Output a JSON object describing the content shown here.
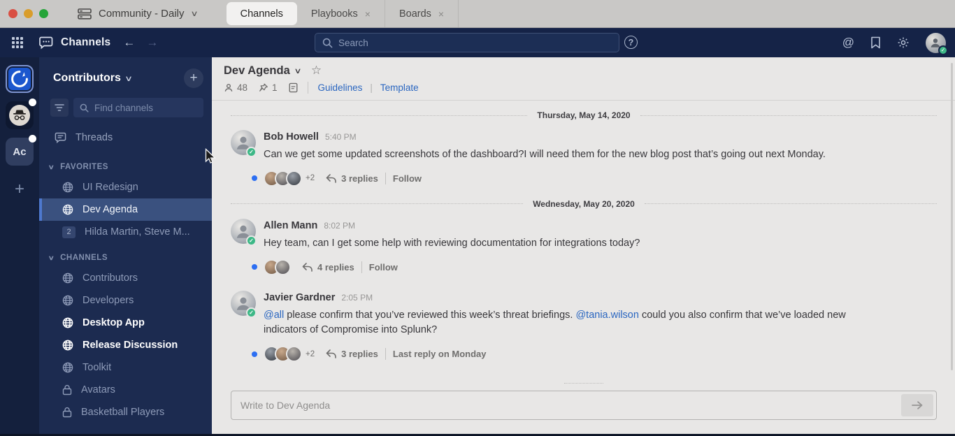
{
  "os_bar": {
    "workspace_name": "Community - Daily",
    "tabs": [
      {
        "label": "Channels"
      },
      {
        "label": "Playbooks",
        "close": "×"
      },
      {
        "label": "Boards",
        "close": "×"
      }
    ]
  },
  "global_header": {
    "product_name": "Channels",
    "search_placeholder": "Search",
    "at_symbol": "@"
  },
  "team_sidebar": {
    "teams": [
      {
        "name": "mattermost-community",
        "active": true
      },
      {
        "name": "incognito-team",
        "badge": true
      },
      {
        "name": "Ac",
        "badge": true
      }
    ],
    "add_label": "+"
  },
  "sidebar": {
    "team_title": "Contributors",
    "add_label": "+",
    "find_placeholder": "Find channels",
    "threads_label": "Threads",
    "favorites": {
      "label": "FAVORITES",
      "items": [
        {
          "label": "UI Redesign",
          "icon": "globe"
        },
        {
          "label": "Dev Agenda",
          "icon": "globe",
          "selected": true
        },
        {
          "label": "Hilda Martin, Steve M...",
          "badge": "2"
        }
      ]
    },
    "channels": {
      "label": "CHANNELS",
      "items": [
        {
          "label": "Contributors",
          "icon": "globe"
        },
        {
          "label": "Developers",
          "icon": "globe"
        },
        {
          "label": "Desktop App",
          "icon": "globe",
          "unread": true
        },
        {
          "label": "Release Discussion",
          "icon": "globe",
          "unread": true
        },
        {
          "label": "Toolkit",
          "icon": "globe"
        },
        {
          "label": "Avatars",
          "icon": "lock"
        },
        {
          "label": "Basketball Players",
          "icon": "lock"
        }
      ]
    }
  },
  "channel": {
    "title": "Dev Agenda",
    "member_count": "48",
    "pinned_count": "1",
    "links": {
      "guidelines": "Guidelines",
      "template": "Template"
    },
    "link_sep": "|"
  },
  "feed": {
    "divider1": "Thursday, May 14, 2020",
    "post1": {
      "author": "Bob Howell",
      "time": "5:40 PM",
      "text": "Can we get some updated screenshots of the dashboard?I will need them for the new blog post that’s going out next Monday.",
      "overflow": "+2",
      "replies": "3 replies",
      "action": "Follow"
    },
    "divider2": "Wednesday, May 20, 2020",
    "post2": {
      "author": "Allen Mann",
      "time": "8:02 PM",
      "text": "Hey team, can I get some help with reviewing documentation for integrations today?",
      "replies": "4 replies",
      "action": "Follow"
    },
    "post3": {
      "author": "Javier Gardner",
      "time": "2:05 PM",
      "mention1": "@all",
      "text1": " please confirm that you’ve reviewed this week’s threat briefings. ",
      "mention2": "@tania.wilson",
      "text2": " could you also confirm that we’ve loaded new indicators of Compromise into Splunk?",
      "overflow": "+2",
      "replies": "3 replies",
      "action": "Last reply on Monday"
    }
  },
  "composer": {
    "placeholder": "Write to Dev Agenda"
  },
  "colors": {
    "header_navy": "#152347",
    "team_sidebar": "#14203d",
    "channel_sidebar": "#1c2b50",
    "selected_channel_bg": "#3a517f",
    "selected_channel_border": "#4e79cf",
    "unread_dot_blue": "#2d6ff2",
    "link_blue": "#2a66c0",
    "online_green": "#3db887",
    "active_team_blue": "#1c57ce",
    "main_bg": "#e8e7e6"
  }
}
